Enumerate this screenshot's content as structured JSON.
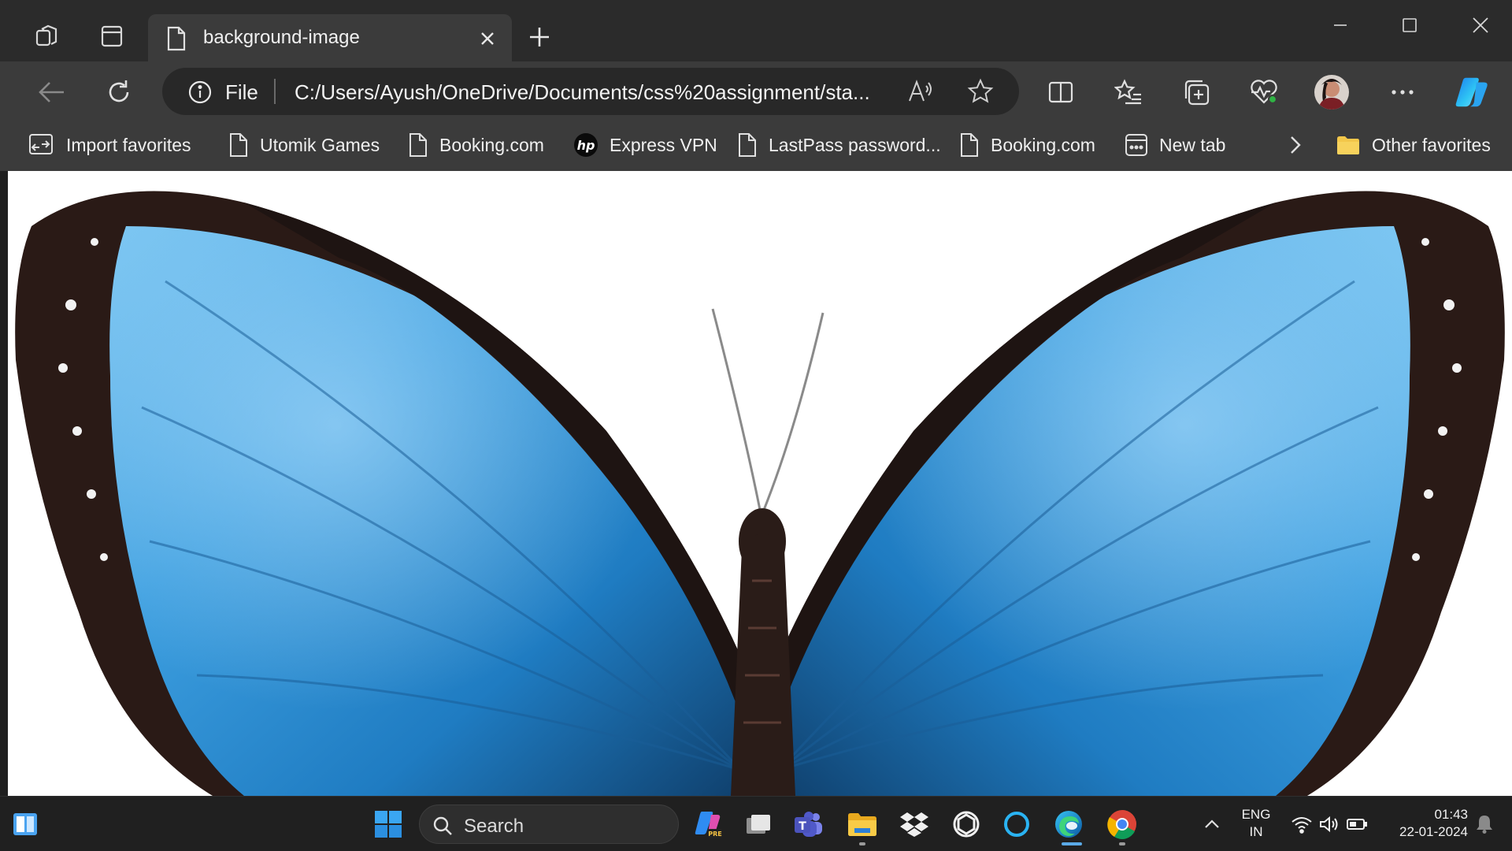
{
  "tab": {
    "title": "background-image"
  },
  "address": {
    "scheme_label": "File",
    "url": "C:/Users/Ayush/OneDrive/Documents/css%20assignment/sta...",
    "read_aloud_glyph": "A⁾"
  },
  "favorites": [
    {
      "label": "Import favorites",
      "icon": "import-icon"
    },
    {
      "label": "Utomik Games",
      "icon": "page-icon"
    },
    {
      "label": "Booking.com",
      "icon": "page-icon"
    },
    {
      "label": "Express VPN",
      "icon": "hp-icon"
    },
    {
      "label": "LastPass password...",
      "icon": "page-icon"
    },
    {
      "label": "Booking.com",
      "icon": "page-icon"
    },
    {
      "label": "New tab",
      "icon": "newtab-icon"
    },
    {
      "label": "Other favorites",
      "icon": "folder-icon"
    }
  ],
  "taskbar": {
    "search_placeholder": "Search",
    "lang_line1": "ENG",
    "lang_line2": "IN",
    "time": "01:43",
    "date": "22-01-2024"
  },
  "colors": {
    "accent_blue": "#3aa0e6",
    "wing_dark": "#2a1a16",
    "chrome_bg": "#3b3b3b"
  }
}
